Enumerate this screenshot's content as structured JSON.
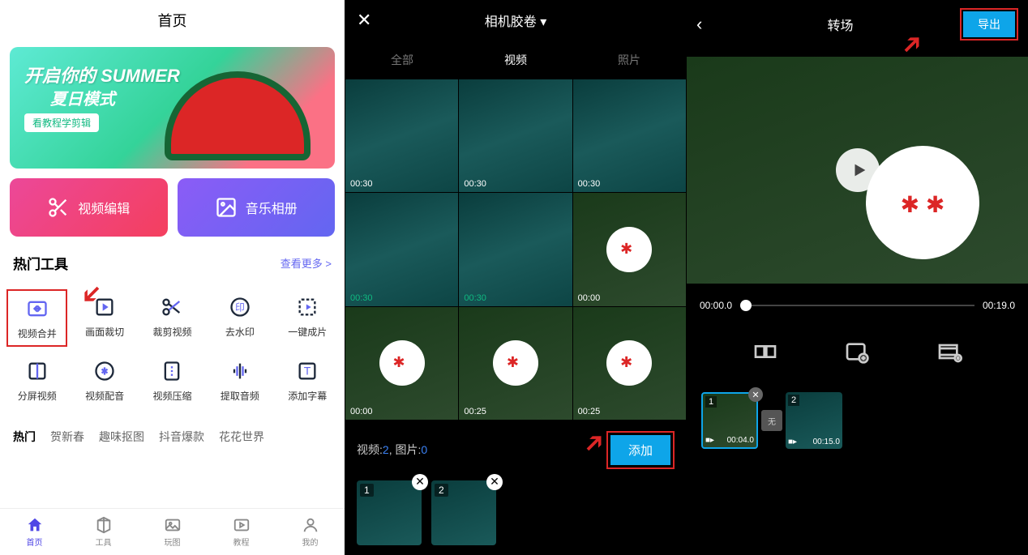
{
  "screen1": {
    "header": "首页",
    "banner": {
      "title": "开启你的 SUMMER",
      "subtitle": "夏日模式",
      "tag": "看教程学剪辑"
    },
    "cards": {
      "video_edit": "视频编辑",
      "music_album": "音乐相册"
    },
    "tools_section": {
      "title": "热门工具",
      "more": "查看更多 >"
    },
    "tools": [
      {
        "label": "视频合并"
      },
      {
        "label": "画面裁切"
      },
      {
        "label": "裁剪视频"
      },
      {
        "label": "去水印"
      },
      {
        "label": "一键成片"
      },
      {
        "label": "分屏视频"
      },
      {
        "label": "视频配音"
      },
      {
        "label": "视频压缩"
      },
      {
        "label": "提取音频"
      },
      {
        "label": "添加字幕"
      }
    ],
    "tabs": [
      "热门",
      "贺新春",
      "趣味抠图",
      "抖音爆款",
      "花花世界"
    ],
    "nav": [
      {
        "label": "首页"
      },
      {
        "label": "工具"
      },
      {
        "label": "玩图"
      },
      {
        "label": "教程"
      },
      {
        "label": "我的"
      }
    ]
  },
  "screen2": {
    "title": "相机胶卷 ▾",
    "tabs": {
      "all": "全部",
      "video": "视频",
      "photo": "照片"
    },
    "durations": [
      "00:30",
      "00:30",
      "00:30",
      "00:30",
      "00:30",
      "00:00",
      "00:00",
      "00:25",
      "00:25"
    ],
    "selection": {
      "prefix": "视频:",
      "vcount": "2",
      "mid": ", 图片:",
      "pcount": "0"
    },
    "add_btn": "添加",
    "thumbs": [
      {
        "n": "1"
      },
      {
        "n": "2"
      }
    ]
  },
  "screen3": {
    "title": "转场",
    "export": "导出",
    "time_start": "00:00.0",
    "time_end": "00:19.0",
    "clips": [
      {
        "n": "1",
        "dur": "00:04.0"
      },
      {
        "n": "2",
        "dur": "00:15.0"
      }
    ],
    "transition": "无"
  }
}
